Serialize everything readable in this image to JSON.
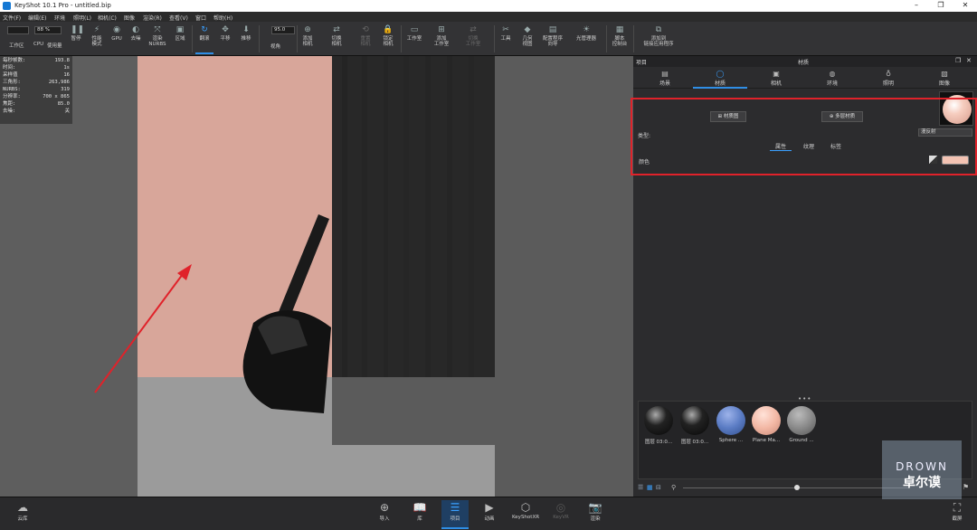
{
  "window": {
    "title": "KeyShot 10.1 Pro  - untitled.bip",
    "minimize": "–",
    "maximize": "❐",
    "close": "✕"
  },
  "menu": [
    "文件(F)",
    "编辑(E)",
    "环境",
    "照明(L)",
    "相机(C)",
    "图像",
    "渲染(R)",
    "查看(V)",
    "窗口",
    "帮助(H)"
  ],
  "toolbar": {
    "zoom_value": "88 %",
    "fov_value": "95.0",
    "items": [
      {
        "label": "工作区",
        "icon": "workspace-icon"
      },
      {
        "label": "CPU",
        "icon": "cpu-icon"
      },
      {
        "label": "使用量",
        "icon": "usage-icon"
      },
      {
        "label": "暂停",
        "icon": "pause-icon"
      },
      {
        "label": "性能\n模式",
        "icon": "performance-icon"
      },
      {
        "label": "GPU",
        "icon": "gpu-icon"
      },
      {
        "label": "去噪",
        "icon": "denoise-icon"
      },
      {
        "label": "渲染\nNURBS",
        "icon": "nurbs-icon"
      },
      {
        "label": "区域",
        "icon": "region-icon"
      },
      {
        "label": "翻滚",
        "icon": "tumble-icon"
      },
      {
        "label": "平移",
        "icon": "pan-icon"
      },
      {
        "label": "推移",
        "icon": "dolly-icon"
      },
      {
        "label": "视角",
        "icon": "perspective-icon"
      },
      {
        "label": "添加\n相机",
        "icon": "add-camera-icon"
      },
      {
        "label": "切换\n相机",
        "icon": "switch-camera-icon"
      },
      {
        "label": "重置\n相机",
        "icon": "reset-camera-icon"
      },
      {
        "label": "锁定\n相机",
        "icon": "lock-camera-icon"
      },
      {
        "label": "工作室",
        "icon": "studio-icon"
      },
      {
        "label": "添加\n工作室",
        "icon": "add-studio-icon"
      },
      {
        "label": "切换\n工作室",
        "icon": "switch-studio-icon"
      },
      {
        "label": "工具",
        "icon": "tools-icon"
      },
      {
        "label": "几何\n视图",
        "icon": "geometry-view-icon"
      },
      {
        "label": "配置程序\n向导",
        "icon": "configurator-icon"
      },
      {
        "label": "光管理器",
        "icon": "light-manager-icon"
      },
      {
        "label": "脚本\n控制台",
        "icon": "script-console-icon"
      },
      {
        "label": "添加到\n链接应用程序",
        "icon": "link-app-icon"
      }
    ]
  },
  "stats": [
    {
      "k": "每秒帧数:",
      "v": "193.8"
    },
    {
      "k": "时间:",
      "v": "1s"
    },
    {
      "k": "采样值",
      "v": "16"
    },
    {
      "k": "三角形:",
      "v": "263,986"
    },
    {
      "k": "NURBS:",
      "v": "319"
    },
    {
      "k": "分辨率:",
      "v": "700 x 865"
    },
    {
      "k": "焦距:",
      "v": "85.0"
    },
    {
      "k": "去噪:",
      "v": "关"
    }
  ],
  "panel": {
    "header_left": "项目",
    "header_center": "材质",
    "tabs": [
      {
        "label": "场景",
        "icon": "scene-icon"
      },
      {
        "label": "材质",
        "icon": "material-icon"
      },
      {
        "label": "相机",
        "icon": "camera-icon"
      },
      {
        "label": "环境",
        "icon": "environment-icon"
      },
      {
        "label": "照明",
        "icon": "lighting-icon"
      },
      {
        "label": "图像",
        "icon": "image-icon"
      }
    ],
    "material": {
      "material_graph": "材质图",
      "multi_material": "多层材质",
      "type_label": "类型:",
      "type_value": "漫反射",
      "subtabs": [
        "属性",
        "纹理",
        "标签"
      ],
      "color_label": "颜色",
      "color_hex": "#f3c3b3"
    },
    "library": [
      {
        "label": "图层 03:0...",
        "color": "#1a1a1a"
      },
      {
        "label": "图层 03:0...",
        "color": "#1a1a1a"
      },
      {
        "label": "Sphere ...",
        "color": "#5b7cc4"
      },
      {
        "label": "Plane Ma...",
        "color": "#f3b8a5"
      },
      {
        "label": "Ground ...",
        "color": "#8a8a8a"
      }
    ]
  },
  "bottombar": [
    {
      "label": "云库",
      "icon": "cloud-library-icon"
    },
    {
      "label": "导入",
      "icon": "import-icon"
    },
    {
      "label": "库",
      "icon": "library-icon"
    },
    {
      "label": "项目",
      "icon": "project-icon"
    },
    {
      "label": "动画",
      "icon": "animation-icon"
    },
    {
      "label": "KeyShotXR",
      "icon": "keyshotxr-icon"
    },
    {
      "label": "KeyVR",
      "icon": "keyvr-icon"
    },
    {
      "label": "渲染",
      "icon": "render-icon"
    },
    {
      "label": "截屏",
      "icon": "screenshot-icon"
    }
  ],
  "watermark": {
    "line1": "DROWN",
    "line2": "卓尔谟"
  }
}
